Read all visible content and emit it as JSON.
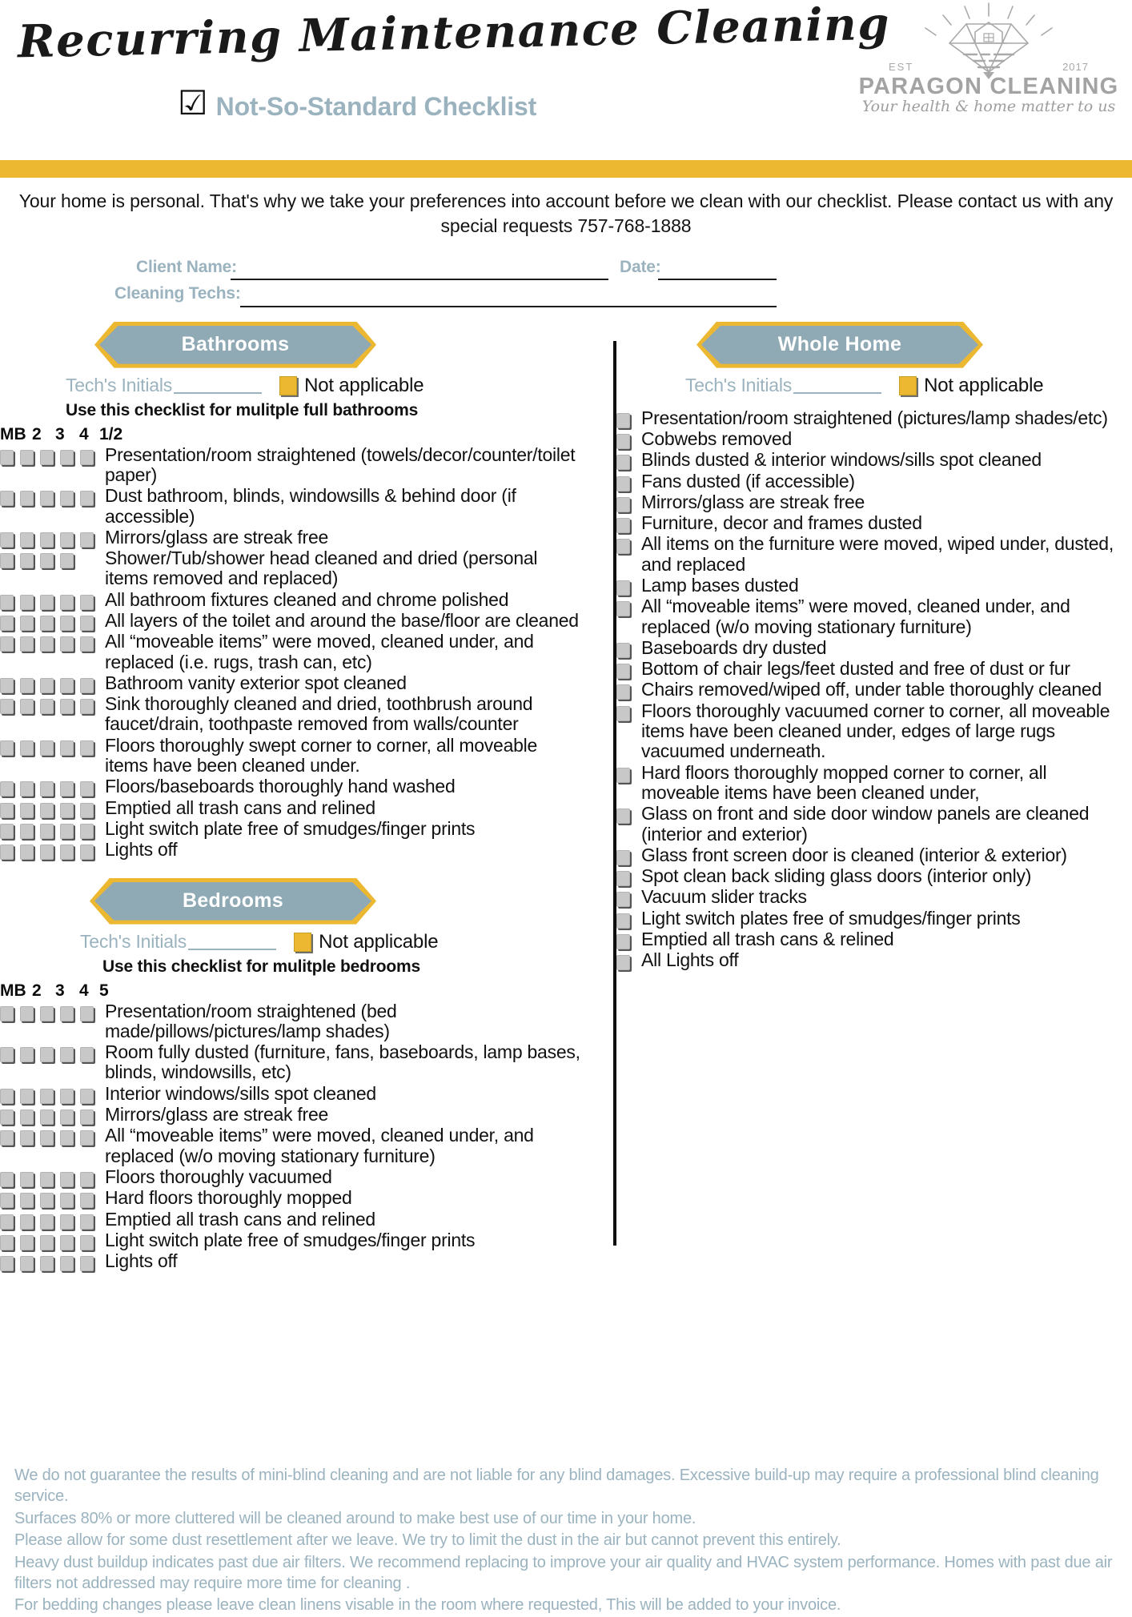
{
  "header": {
    "script_title": "Recurring Maintenance Cleaning",
    "check_icon": "☑",
    "subtitle": "Not-So-Standard Checklist",
    "logo": {
      "wordmark": "PARAGON CLEANING",
      "tagline": "Your health & home matter to us",
      "est_label": "EST",
      "est_year": "2017"
    },
    "accent_gold": "#ecb731",
    "accent_blue_gray": "#8fa9b5"
  },
  "intro": "Your home is personal. That's why we take your preferences into account before we clean with our checklist. Please contact us with any special requests 757-768-1888",
  "fields": {
    "client_name_label": "Client Name:",
    "client_name_value": "",
    "date_label": "Date:",
    "date_value": "",
    "cleaning_techs_label": "Cleaning Techs:",
    "cleaning_techs_value": ""
  },
  "common": {
    "tech_initials_label": "Tech's Initials",
    "tech_initials_value": "",
    "not_applicable_label": "Not applicable"
  },
  "sections": {
    "bathrooms": {
      "title": "Bathrooms",
      "use_note": "Use this checklist for mulitple full bathrooms",
      "column_headers": [
        "MB",
        "2",
        "3",
        "4",
        "1/2"
      ],
      "items": [
        {
          "text": "Presentation/room straightened (towels/decor/counter/toilet paper)",
          "boxes": 5
        },
        {
          "text": "Dust bathroom, blinds, windowsills & behind door (if accessible)",
          "boxes": 5
        },
        {
          "text": "Mirrors/glass are streak free",
          "boxes": 5
        },
        {
          "text": "Shower/Tub/shower head cleaned and dried (personal items removed and replaced)",
          "boxes": 4
        },
        {
          "text": "All bathroom fixtures cleaned and chrome polished",
          "boxes": 5
        },
        {
          "text": "All layers of the toilet and around the base/floor are cleaned",
          "boxes": 5
        },
        {
          "text": "All “moveable items” were moved, cleaned under, and replaced (i.e. rugs, trash can, etc)",
          "boxes": 5
        },
        {
          "text": "Bathroom vanity exterior spot cleaned",
          "boxes": 5
        },
        {
          "text": "Sink thoroughly cleaned and dried, toothbrush around faucet/drain, toothpaste removed from walls/counter",
          "boxes": 5
        },
        {
          "text": "Floors thoroughly swept corner to corner, all moveable items have been cleaned under.",
          "boxes": 5
        },
        {
          "text": "Floors/baseboards thoroughly hand washed",
          "boxes": 5
        },
        {
          "text": "Emptied all trash cans and relined",
          "boxes": 5
        },
        {
          "text": "Light switch plate free of smudges/finger prints",
          "boxes": 5
        },
        {
          "text": "Lights off",
          "boxes": 5
        }
      ]
    },
    "bedrooms": {
      "title": "Bedrooms",
      "use_note": "Use this checklist for mulitple bedrooms",
      "column_headers": [
        "MB",
        "2",
        "3",
        "4",
        "5"
      ],
      "items": [
        {
          "text": "Presentation/room straightened (bed made/pillows/pictures/lamp shades)",
          "boxes": 5
        },
        {
          "text": "Room fully dusted (furniture, fans, baseboards, lamp bases, blinds, windowsills, etc)",
          "boxes": 5
        },
        {
          "text": "Interior windows/sills spot cleaned",
          "boxes": 5
        },
        {
          "text": "Mirrors/glass are streak free",
          "boxes": 5
        },
        {
          "text": "All “moveable items” were moved, cleaned under, and replaced (w/o moving stationary furniture)",
          "boxes": 5
        },
        {
          "text": "Floors thoroughly vacuumed",
          "boxes": 5
        },
        {
          "text": "Hard floors thoroughly mopped",
          "boxes": 5
        },
        {
          "text": "Emptied all trash cans and relined",
          "boxes": 5
        },
        {
          "text": "Light switch plate free of smudges/finger prints",
          "boxes": 5
        },
        {
          "text": "Lights off",
          "boxes": 5
        }
      ]
    },
    "whole_home": {
      "title": "Whole Home",
      "items": [
        {
          "text": "Presentation/room straightened (pictures/lamp shades/etc)",
          "boxes": 1
        },
        {
          "text": "Cobwebs removed",
          "boxes": 1
        },
        {
          "text": "Blinds dusted & interior windows/sills spot cleaned",
          "boxes": 1
        },
        {
          "text": "Fans dusted (if accessible)",
          "boxes": 1
        },
        {
          "text": "Mirrors/glass are streak free",
          "boxes": 1
        },
        {
          "text": "Furniture, decor and frames dusted",
          "boxes": 1
        },
        {
          "text": "All items on the furniture were moved, wiped under, dusted, and replaced",
          "boxes": 1
        },
        {
          "text": "Lamp bases dusted",
          "boxes": 1
        },
        {
          "text": "All “moveable items” were moved, cleaned under, and replaced (w/o moving stationary furniture)",
          "boxes": 1
        },
        {
          "text": "Baseboards dry dusted",
          "boxes": 1
        },
        {
          "text": "Bottom of chair legs/feet dusted and free of dust or fur",
          "boxes": 1
        },
        {
          "text": "Chairs removed/wiped off, under table thoroughly cleaned",
          "boxes": 1
        },
        {
          "text": "Floors thoroughly vacuumed corner to corner, all moveable items have been cleaned under, edges of large rugs vacuumed underneath.",
          "boxes": 1
        },
        {
          "text": "Hard floors thoroughly mopped corner to corner, all moveable items have been cleaned under,",
          "boxes": 1
        },
        {
          "text": "Glass on front and side door window panels are cleaned (interior and exterior)",
          "boxes": 1
        },
        {
          "text": "Glass front screen door is cleaned (interior & exterior)",
          "boxes": 1
        },
        {
          "text": "Spot clean back sliding glass doors (interior only)",
          "boxes": 1
        },
        {
          "text": "Vacuum slider tracks",
          "boxes": 1
        },
        {
          "text": "Light switch plates free of smudges/finger prints",
          "boxes": 1
        },
        {
          "text": "Emptied all trash cans & relined",
          "boxes": 1
        },
        {
          "text": "All Lights off",
          "boxes": 1
        }
      ]
    }
  },
  "footer": {
    "lines": [
      "We do not guarantee the results of mini-blind cleaning and are not liable for any blind damages. Excessive build-up may require a professional blind cleaning service.",
      "Surfaces 80% or more cluttered will be cleaned around to make best use of our time in your home.",
      "Please allow for some dust resettlement after we leave. We try to limit the dust in the air but cannot prevent this entirely.",
      "Heavy dust buildup indicates past due air filters. We recommend replacing to improve your air quality and HVAC system performance. Homes with past due air filters not addressed may require more time for cleaning  .",
      "For bedding changes please leave clean linens visable in the room where requested, This will be added to your invoice."
    ]
  }
}
